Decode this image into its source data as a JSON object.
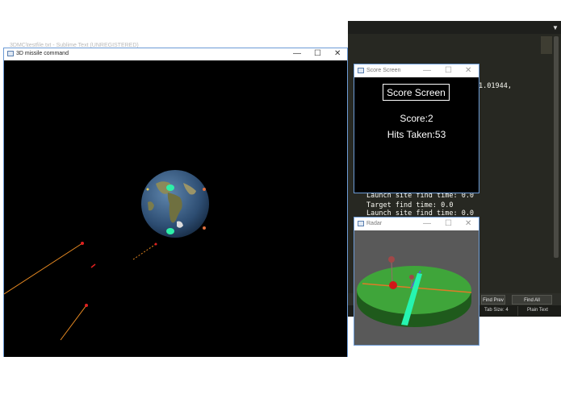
{
  "editor": {
    "title": "3DMC\\testfile.txt - Sublime Text (UNREGISTERED)",
    "code_fragment": "1.01944,",
    "console_lines": [
      "Launch site find time: 0.0",
      "Target find time: 0.0",
      "Launch site find time: 0.0"
    ],
    "find_prev_label": "Find Prev",
    "find_all_label": "Find All",
    "tab_size_label": "Tab Size: 4",
    "syntax_label": "Plain Text",
    "minimize_glyph": "—",
    "maximize_glyph": "❐",
    "close_glyph": "✕",
    "dropdown_glyph": "▼"
  },
  "game_window": {
    "title": "3D missile command",
    "minimize_glyph": "—",
    "maximize_glyph": "☐",
    "close_glyph": "✕"
  },
  "score_window": {
    "title": "Score Screen",
    "heading": "Score Screen",
    "score_text": "Score:2",
    "hits_text": "Hits Taken:53",
    "minimize_glyph": "—",
    "maximize_glyph": "☐",
    "close_glyph": "✕"
  },
  "radar_window": {
    "title": "Radar",
    "minimize_glyph": "—",
    "maximize_glyph": "☐",
    "close_glyph": "✕"
  },
  "colors": {
    "window_border": "#6c9bd6",
    "game_background": "#000000",
    "earth_ocean": "#3b5e86",
    "earth_land": "#7a7b4a",
    "base_marker": "#2ef0a8",
    "missile_head": "#e02020",
    "missile_trail": "#e88a22",
    "radar_disc": "#3fa53a",
    "radar_beam": "#26f5b0"
  }
}
